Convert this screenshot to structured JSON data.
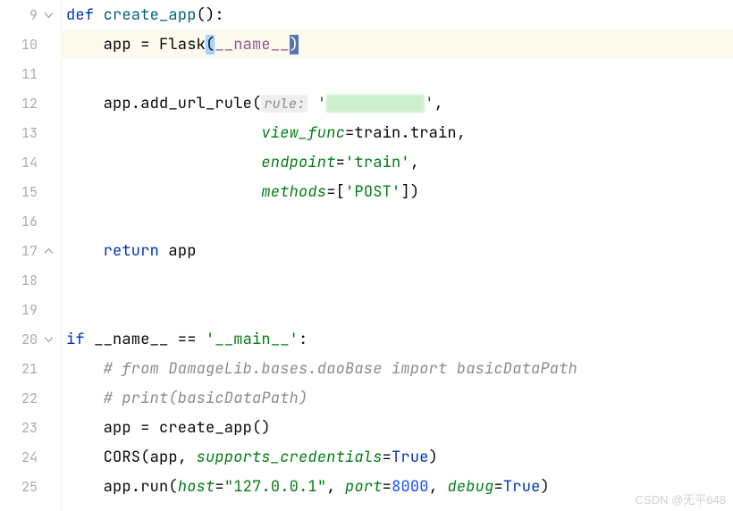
{
  "gutter": {
    "numbers": [
      "9",
      "10",
      "11",
      "12",
      "13",
      "14",
      "15",
      "16",
      "17",
      "18",
      "19",
      "20",
      "21",
      "22",
      "23",
      "24",
      "25"
    ]
  },
  "code": {
    "l9": {
      "kw": "def ",
      "fn": "create_app",
      "tail": "():"
    },
    "l10": {
      "pre": "    app = ",
      "call": "Flask",
      "op": "(",
      "d1": "__name__",
      "cl": ")"
    },
    "l11": {
      "blank": ""
    },
    "l12": {
      "pre": "    app.",
      "m": "add_url_rule",
      "op": "(",
      "hint": "rule:",
      "sp": " '",
      "blur": "",
      "q2": "'",
      "comma": ","
    },
    "l13": {
      "pad": "                     ",
      "p": "view_func",
      "eq": "=train.train,"
    },
    "l14": {
      "pad": "                     ",
      "p": "endpoint",
      "eq": "=",
      "s": "'train'",
      "c": ","
    },
    "l15": {
      "pad": "                     ",
      "p": "methods",
      "eq": "=[",
      "s": "'POST'",
      "cl": "])"
    },
    "l16": {
      "blank": ""
    },
    "l17": {
      "pre": "    ",
      "kw": "return ",
      "id": "app"
    },
    "l18": {
      "blank": ""
    },
    "l19": {
      "blank": ""
    },
    "l20": {
      "kw": "if ",
      "d": "__name__",
      "mid": " == ",
      "s": "'__main__'",
      "colon": ":"
    },
    "l21": {
      "pre": "    ",
      "c": "# from DamageLib.bases.daoBase import basicDataPath"
    },
    "l22": {
      "pre": "    ",
      "c": "# print(basicDataPath)"
    },
    "l23": {
      "pre": "    app = ",
      "fn": "create_app",
      "tail": "()"
    },
    "l24": {
      "pre": "    ",
      "fn": "CORS",
      "op": "(app, ",
      "p": "supports_credentials",
      "eq": "=",
      "b": "True",
      "cl": ")"
    },
    "l25": {
      "pre": "    app.",
      "m": "run",
      "op": "(",
      "p1": "host",
      "e1": "=",
      "s1": "\"127.0.0.1\"",
      "c1": ", ",
      "p2": "port",
      "e2": "=",
      "n": "8000",
      "c2": ", ",
      "p3": "debug",
      "e3": "=",
      "b": "True",
      "cl": ")"
    }
  },
  "watermark": "CSDN @无平648"
}
